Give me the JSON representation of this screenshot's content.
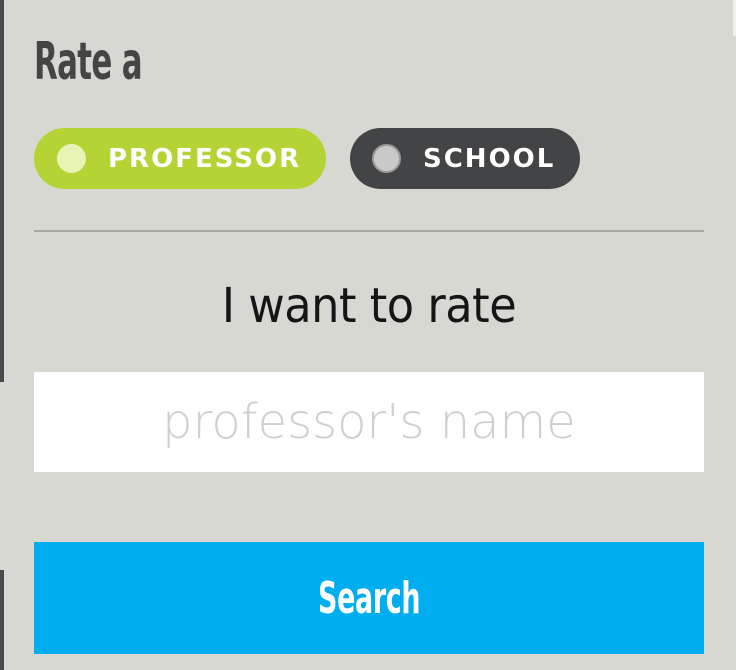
{
  "header": {
    "title": "Rate a"
  },
  "toggles": {
    "professor": {
      "label": "PROFESSOR",
      "selected": true,
      "color": "#b4d334"
    },
    "school": {
      "label": "SCHOOL",
      "selected": false,
      "color": "#434445"
    }
  },
  "prompt": {
    "text": "I want to rate"
  },
  "search": {
    "placeholder": "professor's name",
    "value": "",
    "button_label": "Search",
    "button_color": "#00aeef"
  }
}
